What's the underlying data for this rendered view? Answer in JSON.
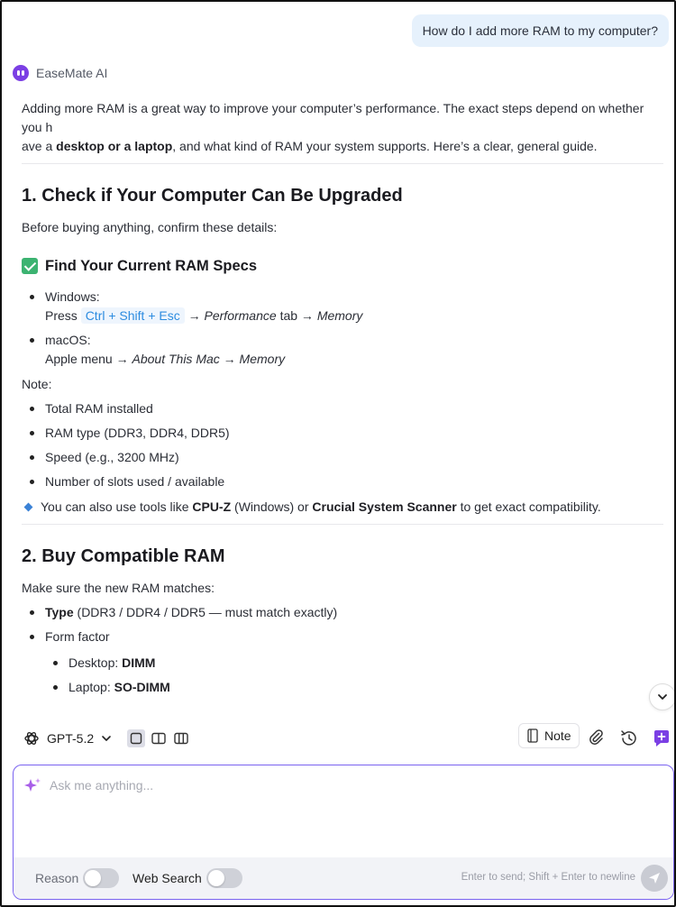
{
  "user_message": "How do I add more RAM to my computer?",
  "assistant": {
    "name": "EaseMate AI",
    "intro_part1": "Adding more RAM is a great way to improve your computer’s performance. The exact steps depend on whether you h",
    "intro_part2_prefix": "ave a ",
    "intro_bold": "desktop or a laptop",
    "intro_part2_suffix": ", and what kind of RAM your system supports. Here’s a clear, general guide.",
    "section1": {
      "heading": "1. Check if Your Computer Can Be Upgraded",
      "lead": "Before buying anything, confirm these details:",
      "subheading": "Find Your Current RAM Specs",
      "windows_label": "Windows",
      "windows_press": "Press",
      "windows_keys": "Ctrl + Shift + Esc",
      "windows_arrow1": "→",
      "windows_tab": "Performance",
      "windows_tab_word": "tab →",
      "windows_memory": "Memory",
      "mac_label": "macOS",
      "mac_menu": "Apple menu →",
      "mac_about": "About This Mac",
      "mac_arrow": "→",
      "mac_memory": "Memory",
      "note_label": "Note:",
      "note_items": [
        "Total RAM installed",
        "RAM type (DDR3, DDR4, DDR5)",
        "Speed (e.g., 3200 MHz)",
        "Number of slots used / available"
      ],
      "tip_prefix": "You can also use tools like",
      "tip_tool1": "CPU-Z",
      "tip_middle": "(Windows) or",
      "tip_tool2": "Crucial System Scanner",
      "tip_suffix": "to get exact compatibility."
    },
    "section2": {
      "heading": "2. Buy Compatible RAM",
      "lead": "Make sure the new RAM matches:",
      "type_label": "Type",
      "type_detail": "(DDR3 / DDR4 / DDR5 — must match exactly)",
      "form_factor": "Form factor",
      "desktop_label": "Desktop:",
      "desktop_value": "DIMM",
      "laptop_label": "Laptop:",
      "laptop_value": "SO-DIMM"
    }
  },
  "toolbar": {
    "model_name": "GPT-5.2",
    "note_label": "Note"
  },
  "input": {
    "placeholder": "Ask me anything...",
    "value": "",
    "reason_label": "Reason",
    "reason_on": false,
    "web_search_label": "Web Search",
    "web_search_on": false,
    "hint": "Enter to send; Shift + Enter to newline"
  },
  "colors": {
    "accent": "#7b3fe4",
    "input_border": "#7a63f0",
    "user_bubble": "#e6f1fc",
    "kbd_text": "#2d8ce0",
    "check_green": "#3cb371"
  }
}
